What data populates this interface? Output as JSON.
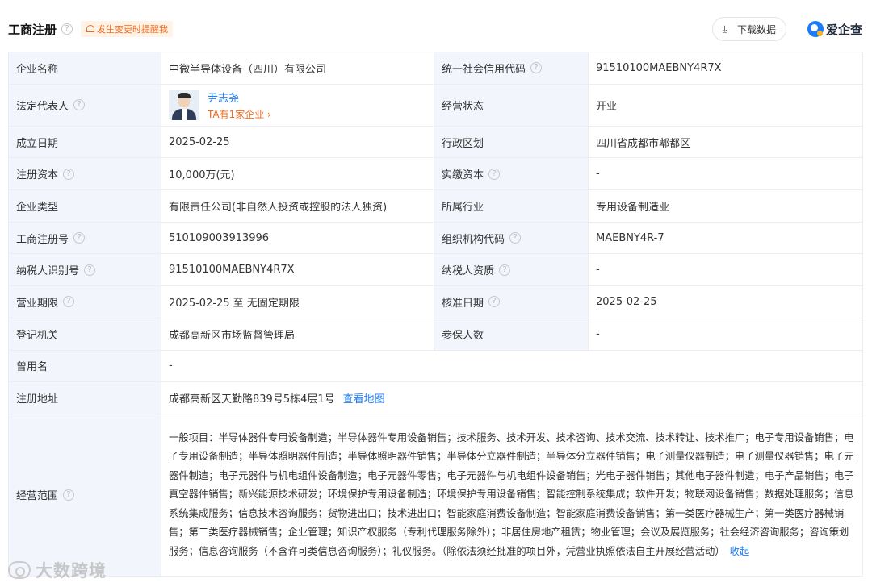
{
  "header": {
    "title": "工商注册",
    "notify_label": "发生变更时提醒我",
    "download_label": "下载数据",
    "logo_text": "爱企查",
    "help_glyph": "?"
  },
  "colors": {
    "accent": "#1f7cf8",
    "orange": "#f26b1d",
    "label_bg": "#f2f6fc"
  },
  "rows": {
    "r1": {
      "l1": "企业名称",
      "v1": "中微半导体设备（四川）有限公司",
      "l2": "统一社会信用代码",
      "v2": "91510100MAEBNY4R7X"
    },
    "r2": {
      "l1": "法定代表人",
      "person_name": "尹志尧",
      "person_sub": "TA有1家企业 ›",
      "l2": "经营状态",
      "v2": "开业"
    },
    "r3": {
      "l1": "成立日期",
      "v1": "2025-02-25",
      "l2": "行政区划",
      "v2": "四川省成都市郫都区"
    },
    "r4": {
      "l1": "注册资本",
      "v1": "10,000万(元)",
      "l2": "实缴资本",
      "v2": "-"
    },
    "r5": {
      "l1": "企业类型",
      "v1": "有限责任公司(非自然人投资或控股的法人独资)",
      "l2": "所属行业",
      "v2": "专用设备制造业"
    },
    "r6": {
      "l1": "工商注册号",
      "v1": "510109003913996",
      "l2": "组织机构代码",
      "v2": "MAEBNY4R-7"
    },
    "r7": {
      "l1": "纳税人识别号",
      "v1": "91510100MAEBNY4R7X",
      "l2": "纳税人资质",
      "v2": "-"
    },
    "r8": {
      "l1": "营业期限",
      "v1": "2025-02-25 至 无固定期限",
      "l2": "核准日期",
      "v2": "2025-02-25"
    },
    "r9": {
      "l1": "登记机关",
      "v1": "成都高新区市场监督管理局",
      "l2": "参保人数",
      "v2": "-"
    },
    "r10": {
      "l1": "曾用名",
      "v1": "-"
    },
    "r11": {
      "l1": "注册地址",
      "v1": "成都高新区天勤路839号5栋4层1号",
      "map_link": "查看地图"
    },
    "r12": {
      "l1": "经营范围",
      "v1": "一般项目：半导体器件专用设备制造；半导体器件专用设备销售；技术服务、技术开发、技术咨询、技术交流、技术转让、技术推广；电子专用设备销售；电子专用设备制造；半导体照明器件制造；半导体照明器件销售；半导体分立器件制造；半导体分立器件销售；电子测量仪器制造；电子测量仪器销售；电子元器件制造；电子元器件与机电组件设备制造；电子元器件零售；电子元器件与机电组件设备销售；光电子器件销售；其他电子器件制造；电子产品销售；电子真空器件销售；新兴能源技术研发；环境保护专用设备制造；环境保护专用设备销售；智能控制系统集成；软件开发；物联网设备销售；数据处理服务；信息系统集成服务；信息技术咨询服务；货物进出口；技术进出口；智能家庭消费设备制造；智能家庭消费设备销售；第一类医疗器械生产；第一类医疗器械销售；第二类医疗器械销售；企业管理；知识产权服务（专利代理服务除外）；非居住房地产租赁；物业管理；会议及展览服务；社会经济咨询服务；咨询策划服务；信息咨询服务（不含许可类信息咨询服务）；礼仪服务。（除依法须经批准的项目外，凭营业执照依法自主开展经营活动）",
      "collapse": "收起"
    }
  },
  "watermark": "大数跨境"
}
